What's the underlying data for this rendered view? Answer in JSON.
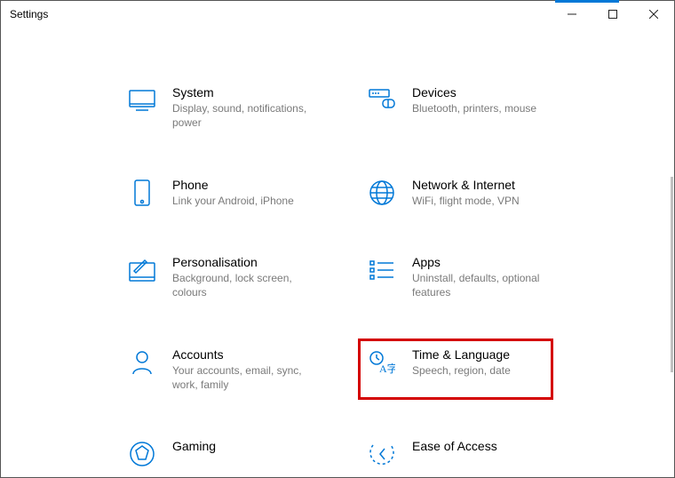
{
  "window": {
    "title": "Settings"
  },
  "tiles": {
    "system": {
      "title": "System",
      "desc": "Display, sound, notifications, power"
    },
    "devices": {
      "title": "Devices",
      "desc": "Bluetooth, printers, mouse"
    },
    "phone": {
      "title": "Phone",
      "desc": "Link your Android, iPhone"
    },
    "network": {
      "title": "Network & Internet",
      "desc": "WiFi, flight mode, VPN"
    },
    "personal": {
      "title": "Personalisation",
      "desc": "Background, lock screen, colours"
    },
    "apps": {
      "title": "Apps",
      "desc": "Uninstall, defaults, optional features"
    },
    "accounts": {
      "title": "Accounts",
      "desc": "Your accounts, email, sync, work, family"
    },
    "time": {
      "title": "Time & Language",
      "desc": "Speech, region, date"
    },
    "gaming": {
      "title": "Gaming",
      "desc": ""
    },
    "ease": {
      "title": "Ease of Access",
      "desc": ""
    }
  }
}
